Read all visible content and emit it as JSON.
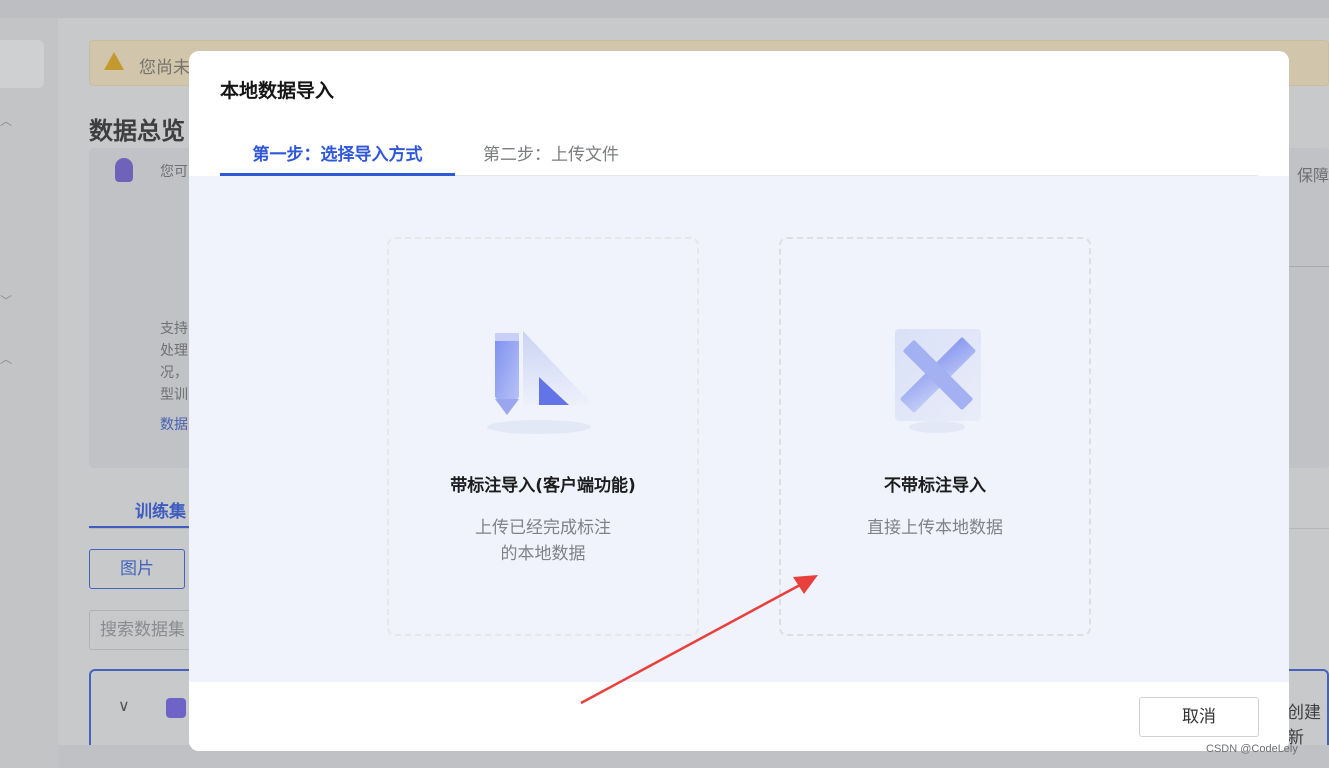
{
  "background": {
    "warning_text": "您尚未",
    "page_title": "数据总览",
    "info_lines": [
      "支持",
      "处理",
      "况，",
      "型训"
    ],
    "info_top_text": "您可",
    "info_link": "数据",
    "right_text": "保障",
    "tab_label": "训练集",
    "filter_button": "图片",
    "search_placeholder": "搜索数据集",
    "create_label": "创建新"
  },
  "modal": {
    "title": "本地数据导入",
    "tabs": [
      {
        "label": "第一步：选择导入方式",
        "active": true
      },
      {
        "label": "第二步：上传文件",
        "active": false
      }
    ],
    "options": [
      {
        "title": "带标注导入(客户端功能)",
        "desc_lines": [
          "上传已经完成标注",
          "的本地数据"
        ],
        "icon": "ruler-pencil-triangle-icon"
      },
      {
        "title": "不带标注导入",
        "desc_lines": [
          "直接上传本地数据"
        ],
        "icon": "crossed-ruler-pencil-icon"
      }
    ],
    "cancel_label": "取消"
  },
  "watermark": "CSDN @CodeLely",
  "colors": {
    "accent": "#2f58d6",
    "modal_body_bg": "#f0f3fb",
    "overlay": "#c8c9cb",
    "annotation_arrow": "#e8403d"
  }
}
